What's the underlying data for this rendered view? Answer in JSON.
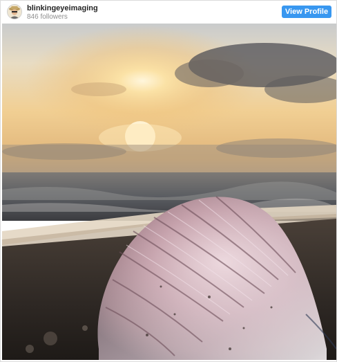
{
  "post": {
    "username": "blinkingeyeimaging",
    "followers": "846 followers",
    "view_profile_label": "View Profile"
  },
  "photo": {
    "subject": "portuguese man o' war on beach at sunrise"
  },
  "colors": {
    "button_bg": "#3897f0",
    "username": "#262626",
    "followers": "#8e8e8e"
  }
}
